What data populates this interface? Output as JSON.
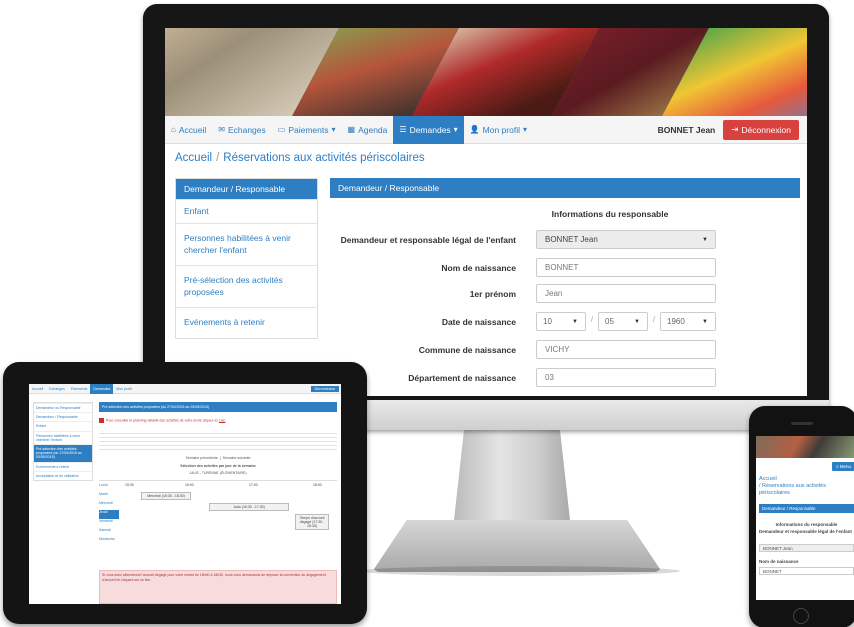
{
  "desktop": {
    "nav": {
      "home": "Accueil",
      "exchanges": "Echanges",
      "payments": "Paiements",
      "agenda": "Agenda",
      "requests": "Demandes",
      "profile": "Mon profil",
      "user": "BONNET Jean",
      "logout": "Déconnexion"
    },
    "breadcrumb": {
      "home": "Accueil",
      "page": "Réservations aux activités périscolaires"
    },
    "sidebar": {
      "header": "Demandeur / Responsable",
      "items": [
        "Enfant",
        "Personnes habilitées à venir chercher l'enfant",
        "Pré-sélection des activités proposées",
        "Evénements à retenir"
      ]
    },
    "panel": {
      "header": "Demandeur / Responsable",
      "title": "Informations du responsable",
      "fields": {
        "legal_label": "Demandeur et responsable légal de l'enfant",
        "legal_value": "BONNET Jean",
        "birthname_label": "Nom de naissance",
        "birthname_value": "BONNET",
        "firstname_label": "1er prénom",
        "firstname_value": "Jean",
        "birthdate_label": "Date de naissance",
        "birth_day": "10",
        "birth_month": "05",
        "birth_year": "1960",
        "birthcity_label": "Commune de naissance",
        "birthcity_value": "VICHY",
        "birthdept_label": "Département de naissance",
        "birthdept_value": "03"
      }
    }
  },
  "tablet": {
    "nav": [
      "Accueil",
      "Echanges",
      "Paiements",
      "Demandes",
      "Mon profil"
    ],
    "logout": "Déconnexion",
    "sidebar": [
      "Demandeur ou Responsable",
      "Demandeur / Responsable",
      "Enfant",
      "Personnes habilitées à venir chercher l'enfant",
      "Pré-sélection des activités proposées (du 27/04/2015 au 03/05/2015)",
      "Evénements à retenir",
      "Acceptation et de validation"
    ],
    "header": "Pré-sélection des activités proposées (du 27/04/2015 au 03/05/2015)",
    "pdf_note": "Pour consulter le planning détaillé des activités de votre école cliquez ici",
    "pdf_link": "Lien",
    "week_label": "Semaine précédente",
    "week_next": "Semaine suivante",
    "select_label": "Sélection des activités par jour de la semaine",
    "select_value": "JALIE - TURENNE (ÉLÉMENTAIRE)",
    "days": [
      "Lundi",
      "Mardi",
      "Mercredi",
      "Jeudi",
      "Vendredi",
      "Samedi",
      "Dimanche"
    ],
    "times": [
      "15:30",
      "16:00",
      "17:00",
      "18:00"
    ],
    "events": [
      "Mercredi (15:30 - 18:30)",
      "Judo (16:30 - 17:30)",
      "Temps d'accueil",
      "dégagé (17:30 - 18:30)"
    ],
    "alert": "Si vous avez sélectionné l'accueil dégagé pour votre enfant de 18h00 à 18h30, nous vous demandons de déposer la convention du dégagement d'accueil en cliquant sur ce lien."
  },
  "phone": {
    "menu": "Menu",
    "crumb_home": "Accueil",
    "crumb_page": "/ Réservations aux activités périscolaires",
    "header": "Demandeur / Responsable",
    "title": "Informations du responsable",
    "legal_label": "Demandeur et responsable légal de l'enfant",
    "legal_value": "BONNET Jean",
    "birthname_label": "Nom de naissance",
    "birthname_value": "BONNET"
  },
  "colors": {
    "primary": "#2d7ec2",
    "danger": "#d9413f",
    "frame": "#161616"
  }
}
